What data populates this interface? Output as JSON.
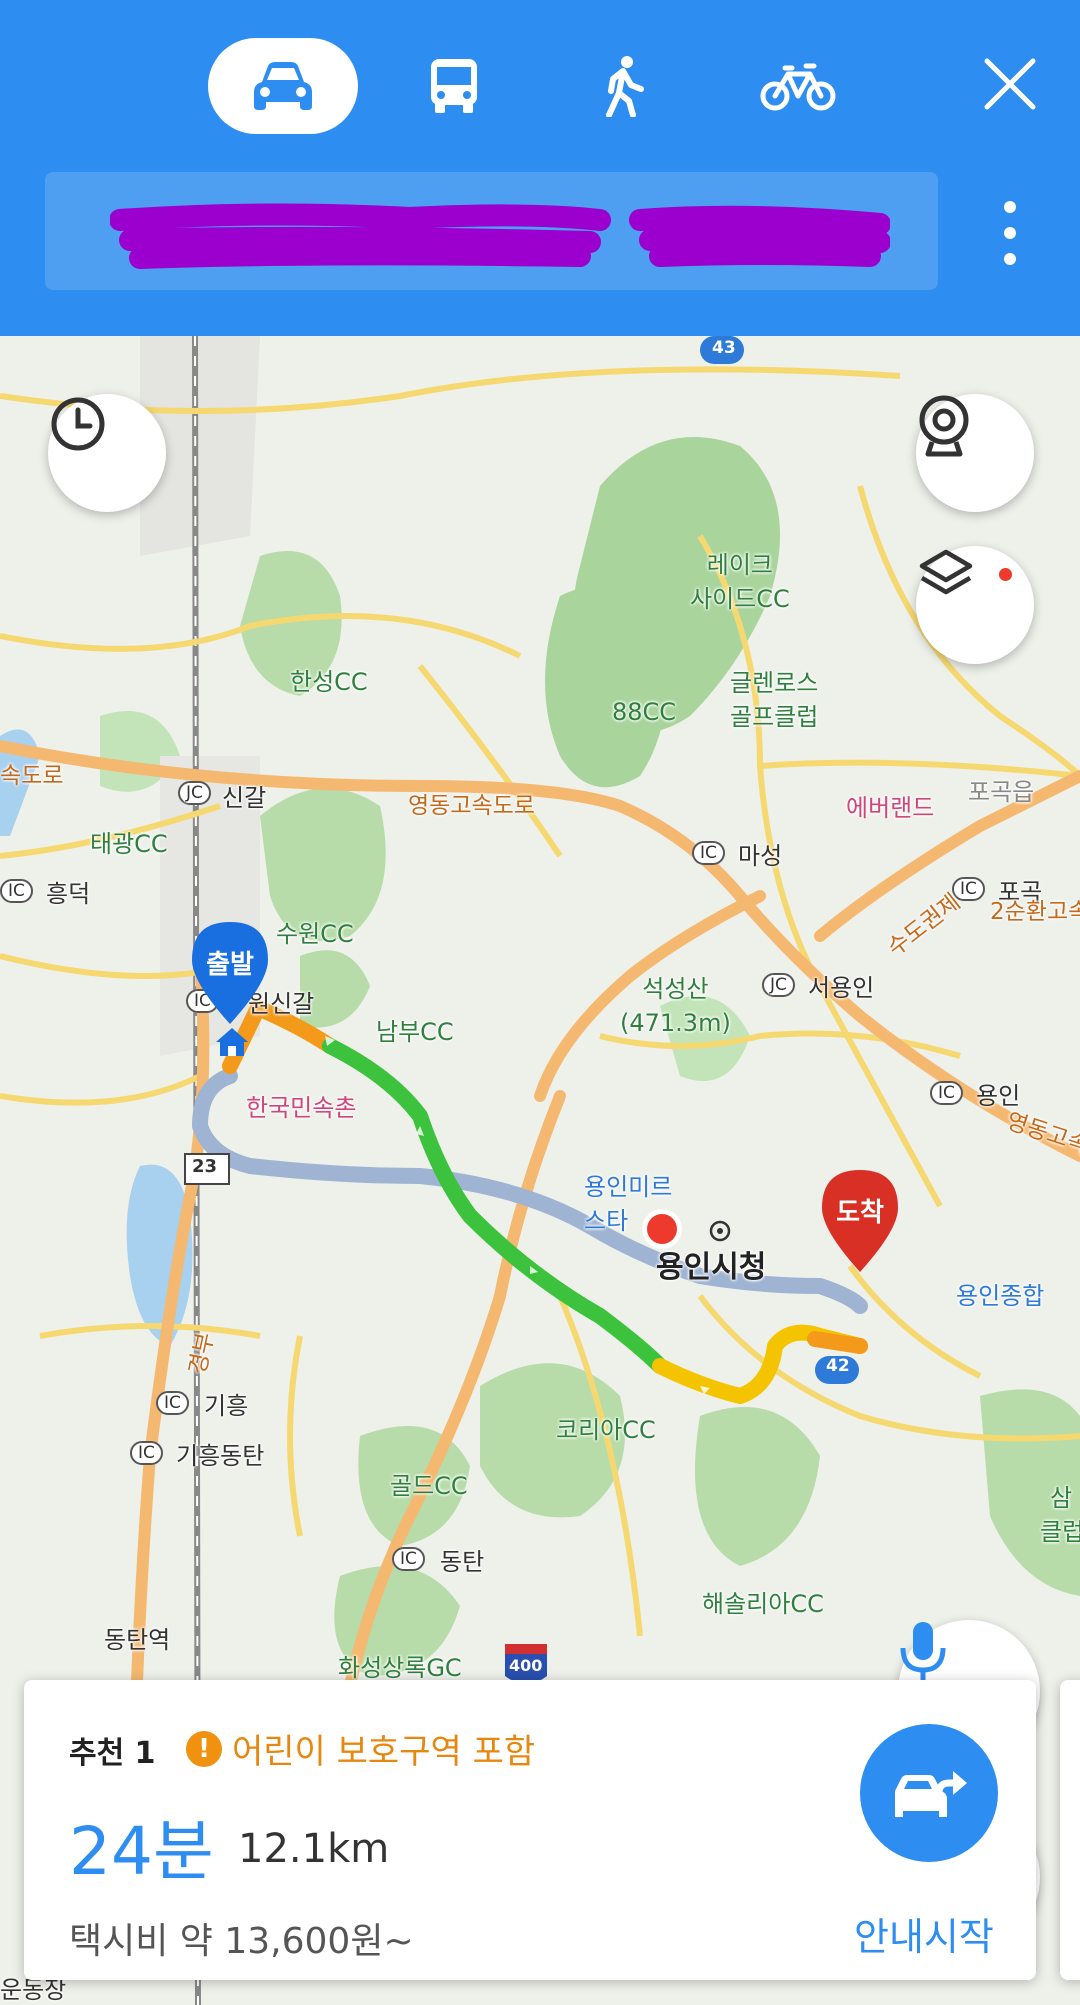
{
  "header": {
    "modes": [
      {
        "name": "car",
        "icon": "car-icon",
        "active": true
      },
      {
        "name": "bus",
        "icon": "bus-icon",
        "active": false
      },
      {
        "name": "walk",
        "icon": "walk-icon",
        "active": false
      },
      {
        "name": "bike",
        "icon": "bike-icon",
        "active": false
      }
    ],
    "close_icon": "close-icon",
    "more_icon": "more-vertical-icon",
    "redaction_color": "#9b00cf"
  },
  "map": {
    "labels": {
      "lake_side_cc": "레이크\n사이드CC",
      "hansung_cc": "한성CC",
      "cc88": "88CC",
      "glenrose": "글렌로스\n골프클럽",
      "everland": "에버랜드",
      "pogok_eup": "포곡읍",
      "singal": "신갈",
      "youngdong_expwy": "영동고속도로",
      "sokdoro_left": "속도로",
      "masung": "마성",
      "pogok": "포곡",
      "sudo_ring": "수도권제",
      "sokdo_right": "2순환고속도",
      "taegwang_cc": "태광CC",
      "heungdeok": "흥덕",
      "suwon_cc": "수원CC",
      "seoksungsan": "석성산\n(471.3m)",
      "seoyongin": "서용인",
      "wonsingal": "원신갈",
      "nambu_cc": "남부CC",
      "yongin_ic": "용인",
      "youngdong_right": "영동고속",
      "folk_village": "한국민속촌",
      "mireu_star": "용인미르\n스타",
      "city_hall": "용인시청",
      "yongin_terminal": "용인종합",
      "giheung": "기흥",
      "giheung_dongtan": "기흥동탄",
      "korea_cc": "코리아CC",
      "gold_cc": "골드CC",
      "dongtan": "동탄",
      "haesolri_cc": "해솔리아CC",
      "dongtan_station": "동탄역",
      "hwaseong_gc": "화성상록GC",
      "gyeongbu": "경부",
      "road_43": "43",
      "road_23": "23",
      "road_400": "400",
      "road_42": "42",
      "right_edge_1": "삼",
      "right_edge_2": "클럽",
      "bottom_left": "운동장"
    },
    "start_label": "출발",
    "end_label": "도착",
    "route_colors": {
      "green": "#3cc23c",
      "yellow": "#f5c400",
      "orange": "#f39a1a",
      "alt": "#9fb4d2"
    },
    "buttons": {
      "history_icon": "clock-icon",
      "cctv_icon": "cctv-icon",
      "layers_icon": "layers-icon",
      "mic_icon": "microphone-icon",
      "locate_icon": "crosshair-icon"
    }
  },
  "route_card": {
    "rank": "추천 1",
    "warning": "어린이 보호구역 포함",
    "warning_icon": "!",
    "duration": "24분",
    "distance": "12.1km",
    "taxi_fare": "택시비 약 13,600원~",
    "start_nav_label": "안내시작",
    "start_nav_icon": "turn-right-car-icon"
  }
}
